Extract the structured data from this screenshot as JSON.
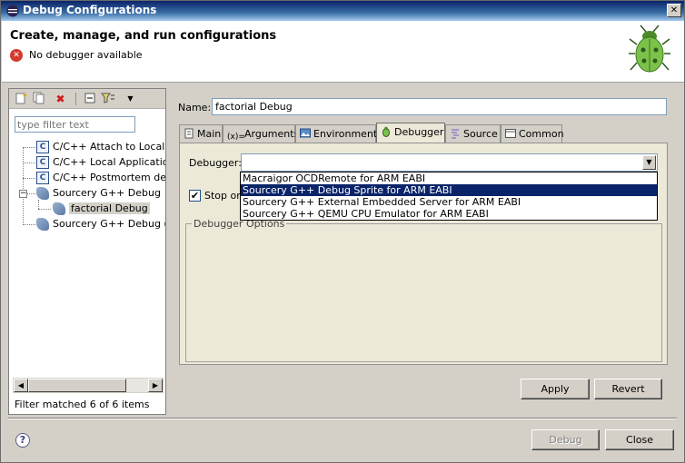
{
  "window": {
    "title": "Debug Configurations"
  },
  "header": {
    "heading": "Create, manage, and run configurations",
    "error_message": "No debugger available"
  },
  "left": {
    "filter_placeholder": "type filter text",
    "tree": [
      {
        "label": "C/C++ Attach to Local A",
        "icon": "c-config-icon"
      },
      {
        "label": "C/C++ Local Application",
        "icon": "c-config-icon"
      },
      {
        "label": "C/C++ Postmortem debu",
        "icon": "c-config-icon"
      },
      {
        "label": "Sourcery G++ Debug",
        "icon": "sourcery-icon"
      },
      {
        "label": "factorial Debug",
        "icon": "sourcery-icon"
      },
      {
        "label": "Sourcery G++ Debug (AI",
        "icon": "sourcery-icon"
      }
    ],
    "filter_status": "Filter matched 6 of 6 items"
  },
  "right": {
    "name_label": "Name:",
    "name_value": "factorial Debug",
    "tabs": [
      {
        "label": "Main",
        "icon": "main-tab-icon"
      },
      {
        "label": "Arguments",
        "icon": "arguments-tab-icon"
      },
      {
        "label": "Environment",
        "icon": "environment-tab-icon"
      },
      {
        "label": "Debugger",
        "icon": "debugger-tab-icon",
        "active": true
      },
      {
        "label": "Source",
        "icon": "source-tab-icon"
      },
      {
        "label": "Common",
        "icon": "common-tab-icon"
      }
    ],
    "debugger_label": "Debugger:",
    "stop_label": "Stop on",
    "stop_checked": true,
    "options_title": "Debugger Options",
    "dropdown_options": [
      "Macraigor OCDRemote for ARM EABI",
      "Sourcery G++ Debug Sprite for ARM EABI",
      "Sourcery G++ External Embedded Server for ARM EABI",
      "Sourcery G++ QEMU CPU Emulator for ARM EABI"
    ],
    "dropdown_selected_index": 1,
    "apply_label": "Apply",
    "revert_label": "Revert"
  },
  "footer": {
    "debug_label": "Debug",
    "close_label": "Close"
  }
}
